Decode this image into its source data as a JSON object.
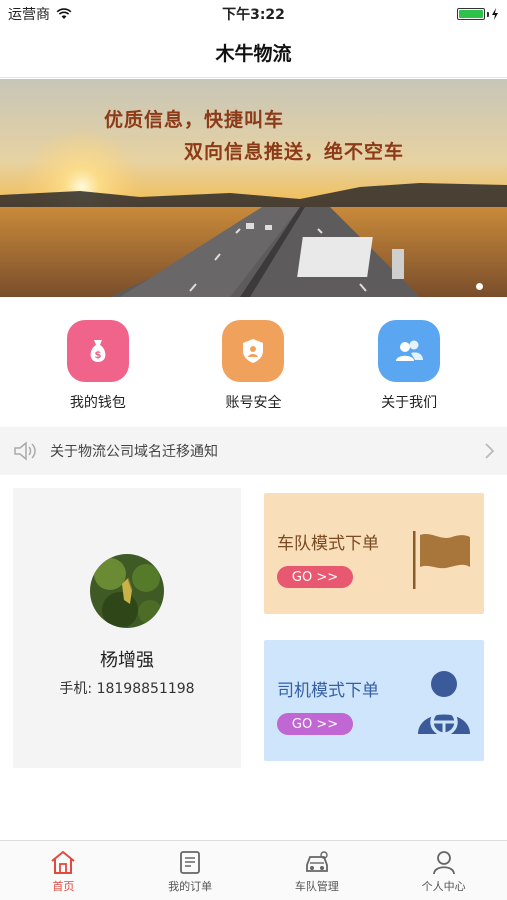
{
  "status": {
    "carrier": "运营商",
    "time": "下午3:22"
  },
  "nav": {
    "title": "木牛物流"
  },
  "banner": {
    "line1": "优质信息，快捷叫车",
    "line2": "双向信息推送，绝不空车"
  },
  "quick": [
    {
      "label": "我的钱包",
      "icon": "money-bag-icon",
      "color": "#f0638a"
    },
    {
      "label": "账号安全",
      "icon": "shield-icon",
      "color": "#f0a25c"
    },
    {
      "label": "关于我们",
      "icon": "people-icon",
      "color": "#5aa6f0"
    }
  ],
  "notice": {
    "text": "关于物流公司域名迁移通知"
  },
  "user": {
    "name": "杨增强",
    "phone": "手机: 18198851198"
  },
  "modes": {
    "fleet": {
      "title": "车队模式下单",
      "go": "GO >>"
    },
    "driver": {
      "title": "司机模式下单",
      "go": "GO >>"
    }
  },
  "tabs": [
    {
      "label": "首页",
      "icon": "home-icon"
    },
    {
      "label": "我的订单",
      "icon": "order-icon"
    },
    {
      "label": "车队管理",
      "icon": "car-icon"
    },
    {
      "label": "个人中心",
      "icon": "person-icon"
    }
  ],
  "colors": {
    "accent": "#e24a3f",
    "fleet_bg": "#f9deba",
    "driver_bg": "#cfe5fb"
  }
}
